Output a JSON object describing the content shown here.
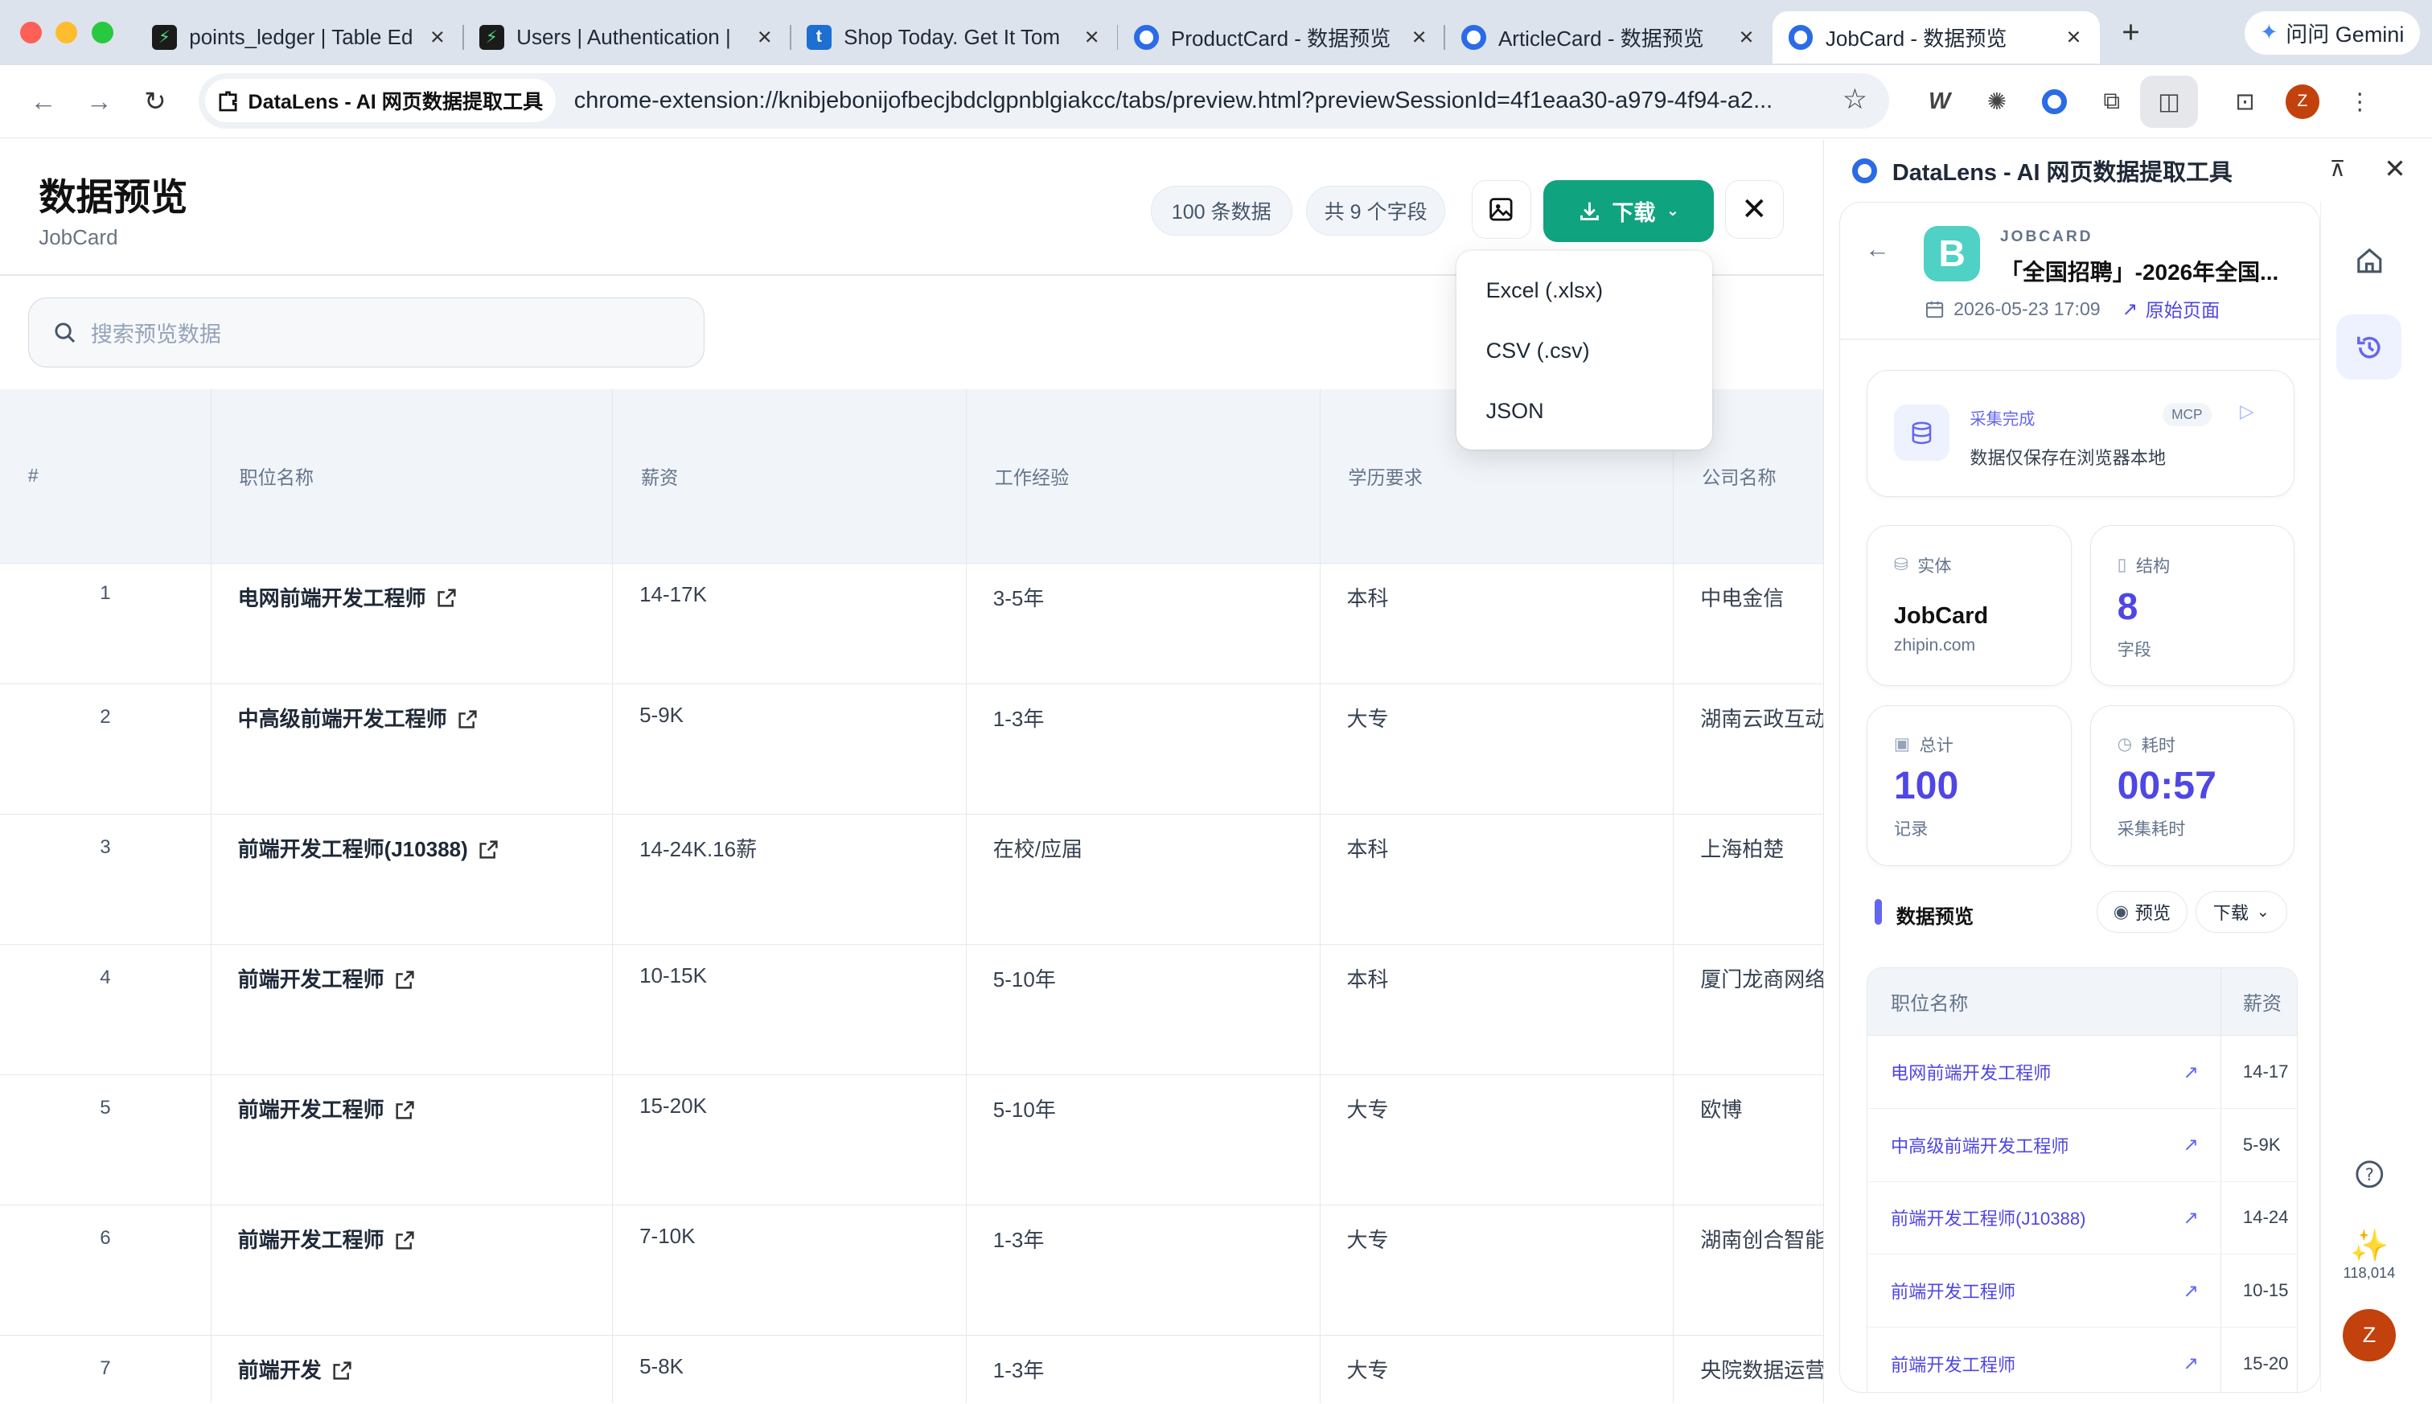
{
  "browser": {
    "tabs": [
      {
        "title": "points_ledger | Table Ed",
        "icon": "supabase-icon"
      },
      {
        "title": "Users | Authentication |",
        "icon": "supabase-icon"
      },
      {
        "title": "Shop Today. Get It Tom",
        "icon": "target-t-icon"
      },
      {
        "title": "ProductCard - 数据预览",
        "icon": "datalens-icon"
      },
      {
        "title": "ArticleCard - 数据预览",
        "icon": "datalens-icon"
      },
      {
        "title": "JobCard - 数据预览",
        "icon": "datalens-icon",
        "active": true
      }
    ],
    "gemini_label": "问问 Gemini",
    "site_chip": "DataLens - AI 网页数据提取工具",
    "url": "chrome-extension://knibjebonijofbecjbdclgpnblgiakcc/tabs/preview.html?previewSessionId=4f1eaa30-a979-4f94-a2...",
    "profile_initial": "Z"
  },
  "page": {
    "title": "数据预览",
    "subtitle": "JobCard",
    "count_pill": "100 条数据",
    "fields_pill": "共 9 个字段",
    "download_label": "下载",
    "search_placeholder": "搜索预览数据",
    "download_menu": [
      "Excel (.xlsx)",
      "CSV (.csv)",
      "JSON"
    ],
    "columns": [
      "#",
      "职位名称",
      "薪资",
      "工作经验",
      "学历要求",
      "公司名称"
    ],
    "rows": [
      {
        "idx": "1",
        "title": "电网前端开发工程师",
        "salary": "14-17K",
        "exp": "3-5年",
        "edu": "本科",
        "company": "中电金信"
      },
      {
        "idx": "2",
        "title": "中高级前端开发工程师",
        "salary": "5-9K",
        "exp": "1-3年",
        "edu": "大专",
        "company": "湖南云政互动"
      },
      {
        "idx": "3",
        "title": "前端开发工程师(J10388)",
        "salary": "14-24K.16薪",
        "exp": "在校/应届",
        "edu": "本科",
        "company": "上海柏楚"
      },
      {
        "idx": "4",
        "title": "前端开发工程师",
        "salary": "10-15K",
        "exp": "5-10年",
        "edu": "本科",
        "company": "厦门龙商网络"
      },
      {
        "idx": "5",
        "title": "前端开发工程师",
        "salary": "15-20K",
        "exp": "5-10年",
        "edu": "大专",
        "company": "欧博"
      },
      {
        "idx": "6",
        "title": "前端开发工程师",
        "salary": "7-10K",
        "exp": "1-3年",
        "edu": "大专",
        "company": "湖南创合智能"
      },
      {
        "idx": "7",
        "title": "前端开发",
        "salary": "5-8K",
        "exp": "1-3年",
        "edu": "大专",
        "company": "央院数据运营"
      }
    ]
  },
  "side": {
    "header_title": "DataLens - AI 网页数据提取工具",
    "source_logo_letter": "B",
    "kind": "JOBCARD",
    "job_title": "「全国招聘」-2026年全国...",
    "date": "2026-05-23 17:09",
    "origin_link": "原始页面",
    "status_title": "采集完成",
    "status_badge": "MCP",
    "status_desc": "数据仅保存在浏览器本地",
    "entity_label": "实体",
    "entity_value": "JobCard",
    "entity_domain": "zhipin.com",
    "struct_label": "结构",
    "struct_value": "8",
    "struct_unit": "字段",
    "total_label": "总计",
    "total_value": "100",
    "total_unit": "记录",
    "time_label": "耗时",
    "time_value": "00:57",
    "time_unit": "采集耗时",
    "preview_section": "数据预览",
    "preview_btn": "预览",
    "download_btn": "下载",
    "preview_columns": [
      "职位名称",
      "薪资"
    ],
    "preview_rows": [
      {
        "title": "电网前端开发工程师",
        "salary": "14-17"
      },
      {
        "title": "中高级前端开发工程师",
        "salary": "5-9K"
      },
      {
        "title": "前端开发工程师(J10388)",
        "salary": "14-24"
      },
      {
        "title": "前端开发工程师",
        "salary": "10-15"
      },
      {
        "title": "前端开发工程师",
        "salary": "15-20"
      }
    ],
    "credits": "118,014",
    "user_initial": "Z"
  },
  "colors": {
    "accent_green": "#10a37f",
    "accent_indigo": "#4f46e5",
    "tab_bar": "#dde3ec"
  }
}
